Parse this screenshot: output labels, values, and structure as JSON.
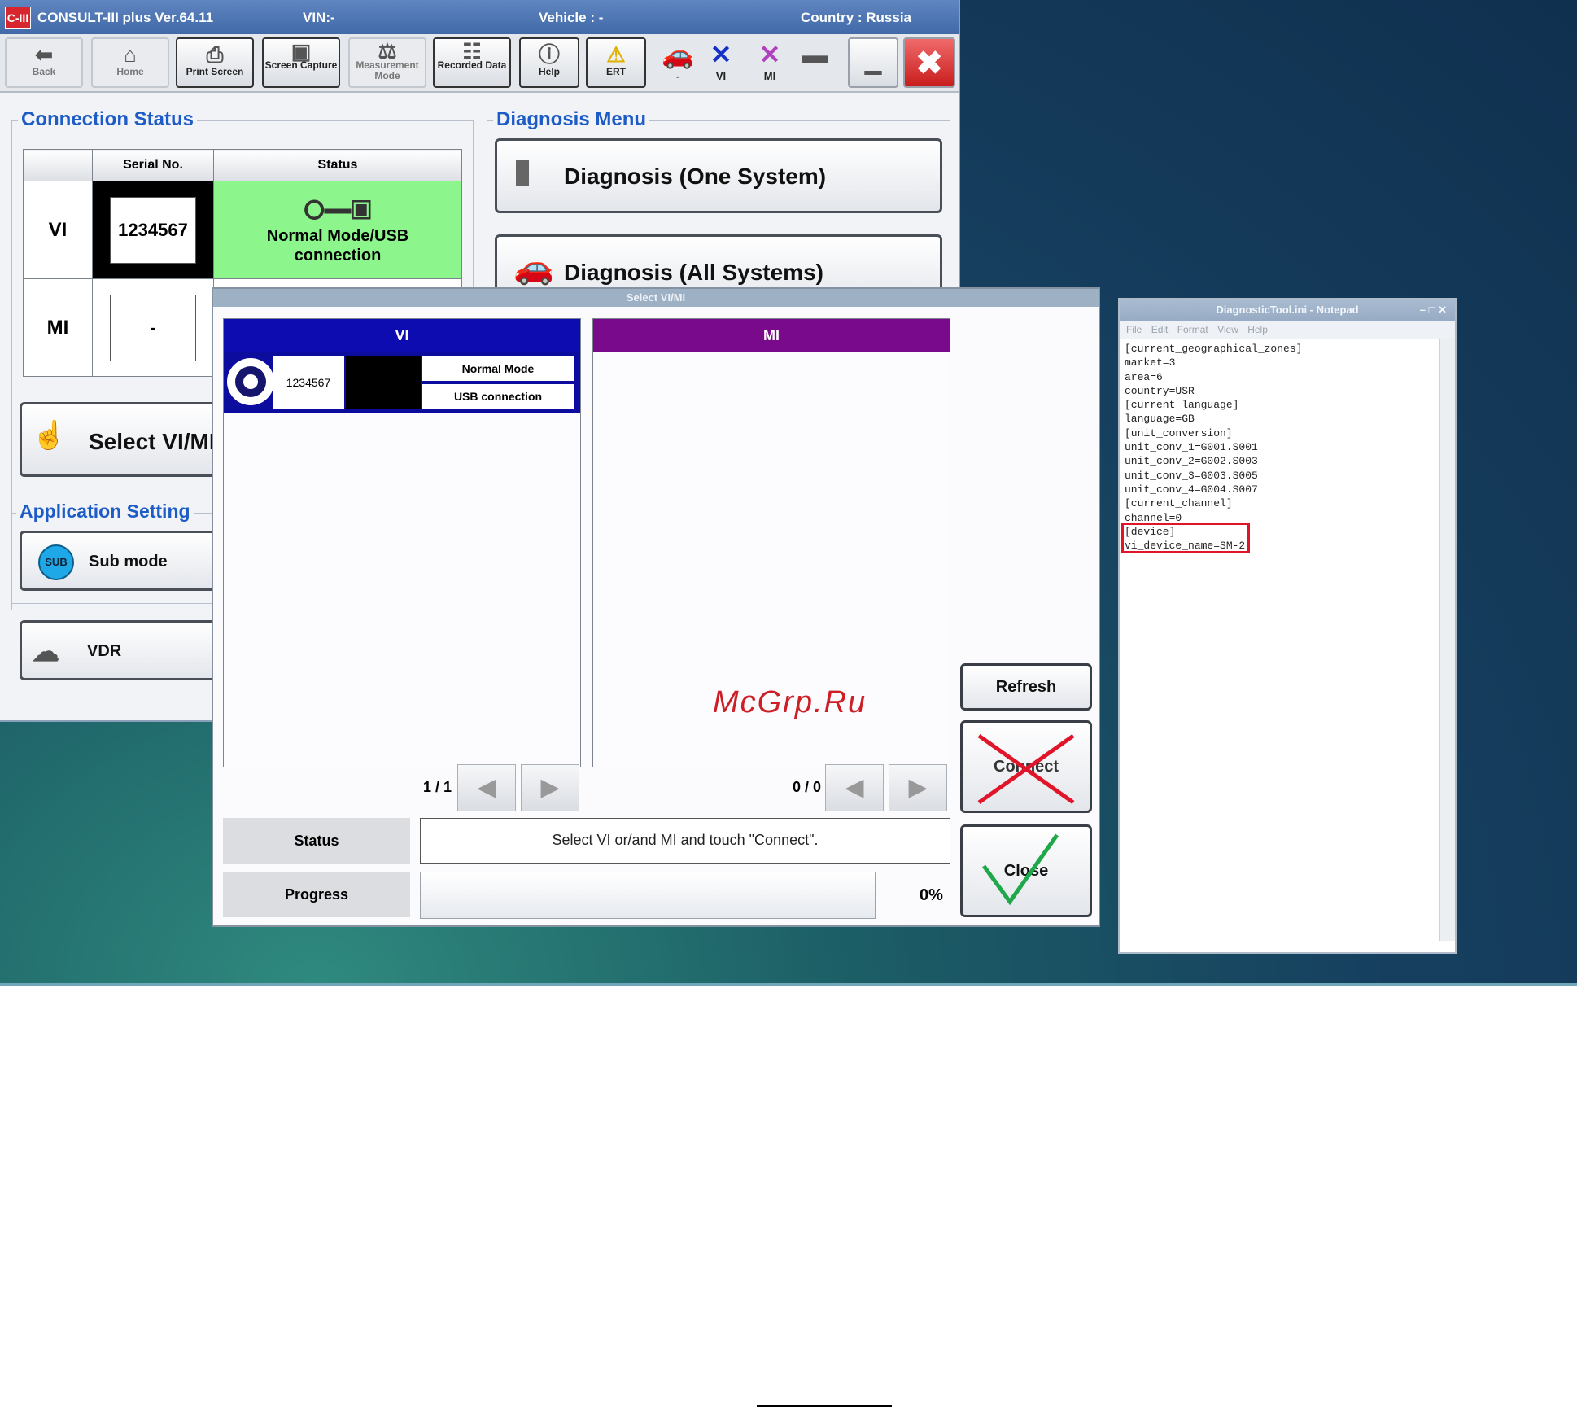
{
  "main_window": {
    "title": "CONSULT-III plus  Ver.64.11",
    "vin": "VIN:-",
    "vehicle": "Vehicle : -",
    "country": "Country : Russia",
    "logo": "C-III"
  },
  "toolbar": {
    "back": "Back",
    "home": "Home",
    "print_screen": "Print Screen",
    "screen_capture": "Screen Capture",
    "measurement_mode": "Measurement Mode",
    "recorded_data": "Recorded Data",
    "help": "Help",
    "ert": "ERT",
    "vehicle_status": "-",
    "vi_status": "VI",
    "mi_status": "MI"
  },
  "connection_status": {
    "title": "Connection Status",
    "col_serial": "Serial No.",
    "col_status": "Status",
    "vi_label": "VI",
    "vi_serial": "1234567",
    "vi_status": "Normal Mode/USB connection",
    "mi_label": "MI",
    "mi_serial": "-"
  },
  "diagnosis_menu": {
    "title": "Diagnosis Menu",
    "one_system": "Diagnosis (One System)",
    "all_systems": "Diagnosis (All Systems)"
  },
  "left_buttons": {
    "select_vimi": "Select VI/MI",
    "app_setting_title": "Application Setting",
    "sub_mode": "Sub mode",
    "sub_badge": "SUB",
    "vdr": "VDR"
  },
  "dialog": {
    "title": "Select VI/MI",
    "vi_header": "VI",
    "mi_header": "MI",
    "vi_item_serial": "1234567",
    "vi_item_mode": "Normal Mode",
    "vi_item_conn": "USB connection",
    "vi_pager": "1 / 1",
    "mi_pager": "0 / 0",
    "status_label": "Status",
    "status_value": "Select VI or/and MI and touch \"Connect\".",
    "progress_label": "Progress",
    "progress_value": "0%",
    "progress": 0,
    "refresh": "Refresh",
    "connect": "Connect",
    "close": "Close"
  },
  "notepad": {
    "title": "DiagnosticTool.ini - Notepad",
    "menu": [
      "File",
      "Edit",
      "Format",
      "View",
      "Help"
    ],
    "lines": [
      "[current_geographical_zones]",
      "market=3",
      "area=6",
      "country=USR",
      "[current_language]",
      "language=GB",
      "[unit_conversion]",
      "unit_conv_1=G001.S001",
      "unit_conv_2=G002.S003",
      "unit_conv_3=G003.S005",
      "unit_conv_4=G004.S007",
      "[current_channel]",
      "channel=0",
      "[device]",
      "vi_device_name=SM-2"
    ]
  },
  "watermark": "McGrp.Ru",
  "colors": {
    "accent": "#1d5bc6",
    "vi_header": "#0c0cb0",
    "mi_header": "#7a0a8c",
    "status_green": "#8cf58c",
    "highlight": "#e0152a"
  }
}
